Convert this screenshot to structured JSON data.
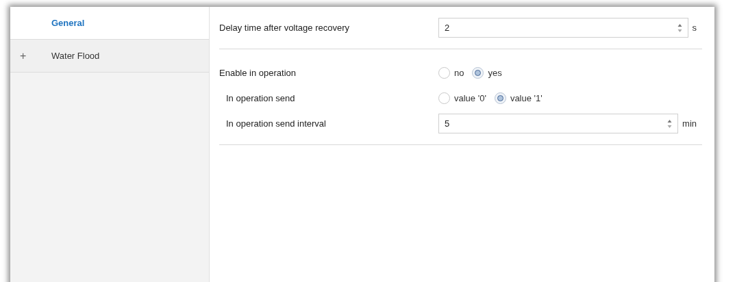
{
  "sidebar": {
    "items": [
      {
        "label": "General",
        "selected": true,
        "expandable": false
      },
      {
        "label": "Water Flood",
        "selected": false,
        "expandable": true,
        "expander": "+"
      }
    ]
  },
  "sections": [
    {
      "rows": [
        {
          "kind": "number",
          "label": "Delay time after voltage recovery",
          "indented": false,
          "value": "2",
          "unit": "s"
        }
      ]
    },
    {
      "rows": [
        {
          "kind": "radio",
          "label": "Enable in operation",
          "indented": false,
          "options": [
            {
              "label": "no",
              "selected": false
            },
            {
              "label": "yes",
              "selected": true
            }
          ]
        },
        {
          "kind": "radio",
          "label": "In operation send",
          "indented": true,
          "options": [
            {
              "label": "value '0'",
              "selected": false
            },
            {
              "label": "value '1'",
              "selected": true
            }
          ]
        },
        {
          "kind": "number",
          "label": "In operation send interval",
          "indented": true,
          "value": "5",
          "unit": "min"
        }
      ]
    }
  ]
}
